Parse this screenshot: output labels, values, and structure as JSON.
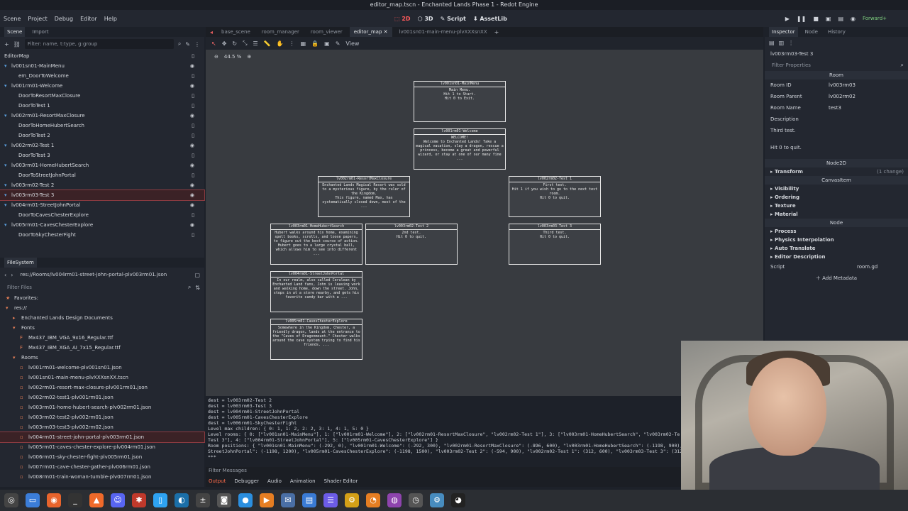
{
  "window": {
    "title": "editor_map.tscn - Enchanted Lands Phase 1 - Redot Engine"
  },
  "menu": [
    "Scene",
    "Project",
    "Debug",
    "Editor",
    "Help"
  ],
  "workspaces": [
    {
      "label": "2D",
      "active": true
    },
    {
      "label": "3D",
      "active": false
    },
    {
      "label": "Script",
      "active": false
    },
    {
      "label": "AssetLib",
      "active": false
    }
  ],
  "renderer": "Forward+",
  "scene_dock": {
    "tabs": [
      "Scene",
      "Import"
    ],
    "filter_placeholder": "Filter: name, t:type, g:group",
    "nodes": [
      {
        "label": "EditorMap",
        "indent": 0
      },
      {
        "label": "lv001sn01-MainMenu",
        "indent": 1
      },
      {
        "label": "em_DoorToWelcome",
        "indent": 2
      },
      {
        "label": "lv001rm01-Welcome",
        "indent": 1
      },
      {
        "label": "DoorToResortMaxClosure",
        "indent": 2
      },
      {
        "label": "DoorToTest 1",
        "indent": 2
      },
      {
        "label": "lv002rm01-ResortMaxClosure",
        "indent": 1
      },
      {
        "label": "DoorToHomeHubertSearch",
        "indent": 2
      },
      {
        "label": "DoorToTest 2",
        "indent": 2
      },
      {
        "label": "lv002rm02-Test 1",
        "indent": 1
      },
      {
        "label": "DoorToTest 3",
        "indent": 2
      },
      {
        "label": "lv003rm01-HomeHubertSearch",
        "indent": 1
      },
      {
        "label": "DoorToStreetJohnPortal",
        "indent": 2
      },
      {
        "label": "lv003rm02-Test 2",
        "indent": 1
      },
      {
        "label": "lv003rm03-Test 3",
        "indent": 1,
        "selected": true
      },
      {
        "label": "lv004rm01-StreetJohnPortal",
        "indent": 1
      },
      {
        "label": "DoorToCavesChesterExplore",
        "indent": 2
      },
      {
        "label": "lv005rm01-CavesChesterExplore",
        "indent": 1
      },
      {
        "label": "DoorToSkyChesterFight",
        "indent": 2
      }
    ]
  },
  "filesystem": {
    "title": "FileSystem",
    "path": "res://Rooms/lv004rm01-street-john-portal-plv003rm01.json",
    "filter_placeholder": "Filter Files",
    "entries": [
      {
        "label": "Favorites:",
        "indent": 0,
        "icon": "★"
      },
      {
        "label": "res://",
        "indent": 0,
        "icon": "▾"
      },
      {
        "label": "Enchanted Lands Design Documents",
        "indent": 1,
        "icon": "▸"
      },
      {
        "label": "Fonts",
        "indent": 1,
        "icon": "▾"
      },
      {
        "label": "Mx437_IBM_VGA_9x16_Regular.ttf",
        "indent": 2,
        "icon": "F"
      },
      {
        "label": "Mx437_IBM_XGA_AI_7x15_Regular.ttf",
        "indent": 2,
        "icon": "F"
      },
      {
        "label": "Rooms",
        "indent": 1,
        "icon": "▾"
      },
      {
        "label": "lv001rm01-welcome-plv001sn01.json",
        "indent": 2,
        "icon": "▫"
      },
      {
        "label": "lv001sn01-main-menu-plvXXXsnXX.tscn",
        "indent": 2,
        "icon": "▫"
      },
      {
        "label": "lv002rm01-resort-max-closure-plv001rm01.json",
        "indent": 2,
        "icon": "▫"
      },
      {
        "label": "lv002rm02-test1-plv001rm01.json",
        "indent": 2,
        "icon": "▫"
      },
      {
        "label": "lv003rm01-home-hubert-search-plv002rm01.json",
        "indent": 2,
        "icon": "▫"
      },
      {
        "label": "lv003rm02-test2-plv002rm01.json",
        "indent": 2,
        "icon": "▫"
      },
      {
        "label": "lv003rm03-test3-plv002rm02.json",
        "indent": 2,
        "icon": "▫"
      },
      {
        "label": "lv004rm01-street-john-portal-plv003rm01.json",
        "indent": 2,
        "icon": "▫",
        "selected": true
      },
      {
        "label": "lv005rm01-caves-chester-explore-plv004rm01.json",
        "indent": 2,
        "icon": "▫"
      },
      {
        "label": "lv006rm01-sky-chester-fight-plv005rm01.json",
        "indent": 2,
        "icon": "▫"
      },
      {
        "label": "lv007rm01-cave-chester-gather-plv006rm01.json",
        "indent": 2,
        "icon": "▫"
      },
      {
        "label": "lv008rm01-train-woman-tumble-plv007rm01.json",
        "indent": 2,
        "icon": "▫"
      }
    ]
  },
  "scene_tabs": [
    {
      "label": "base_scene",
      "active": false
    },
    {
      "label": "room_manager",
      "active": false
    },
    {
      "label": "room_viewer",
      "active": false
    },
    {
      "label": "editor_map",
      "active": true
    },
    {
      "label": "lv001sn01-main-menu-plvXXXsnXX",
      "active": false
    }
  ],
  "viewport": {
    "toolbar_view": "View",
    "zoom": "44.5 %",
    "rooms": [
      {
        "title": "lv001sn01-MainMenu",
        "body": "Main Menu.\nHit 1 to Start.\nHit 0 to Exit."
      },
      {
        "title": "lv001rm01-Welcome",
        "body": "WELCOME!\nWelcome to Enchanted Lands! Take a magical vacation, slay a dragon, rescue a princess, become a great and powerful wizard, or stay at one of our many fine ..."
      },
      {
        "title": "lv002rm01-ResortMaxClosure",
        "body": "Enchanted Lands Magical Resort was sold to a mysterious figure, by the ruler of the Kingdom.\nThis figure, named Max, has systematically closed down, most of the ..."
      },
      {
        "title": "lv002rm02-Test 1",
        "body": "First test.\nHit 1 if you wish to go to the next test room.\nHit 0 to quit."
      },
      {
        "title": "lv003rm01-HomeHubertSearch",
        "body": "Hubert walks around his home, examining spell books, scrolls, and loose papers, to figure out the best course of action. Hubert goes to a large crystal ball, which allows him to see into different ..."
      },
      {
        "title": "lv003rm02-Test 2",
        "body": "2nd test.\nHit 0 to quit."
      },
      {
        "title": "lv003rm03-Test 3",
        "body": "Third test.\nHit 0 to quit."
      },
      {
        "title": "lv004rm01-StreetJohnPortal",
        "body": "In our realm, also called Cerulean by Enchanted Land fans, John is leaving work and walking home, down the street. John, stops in at a store nearby, and gets his favorite candy bar with a ..."
      },
      {
        "title": "lv005rm01-CavesChesterExplore",
        "body": "Somewhere in the Kingdom, Chester, a friendly dragon, lands at the entrance to the \"Caves of Dragonmount.\" Chester walks around the cave system trying to find his friends. ..."
      }
    ]
  },
  "output_lines": [
    "dest = lv003rm02-Test 2",
    "dest = lv003rm03-Test 3",
    "dest = lv004rm01-StreetJohnPortal",
    "dest = lv005rm01-CavesChesterExplore",
    "dest = lv006rm01-SkyChesterFight",
    "Level max children: { 0: 1, 1: 2, 2: 2, 3: 1, 4: 1, 5: 0 }",
    "Level rooms: { 0: [\"lv001sn01-MainMenu\"], 1: [\"lv001rm01-Welcome\"], 2: [\"lv002rm01-ResortMaxClosure\", \"lv002rm02-Test 1\"], 3: [\"lv003rm01-HomeHubertSearch\", \"lv003rm02-Te",
    "Test 3\"], 4: [\"lv004rm01-StreetJohnPortal\"], 5: [\"lv005rm01-CavesChesterExplore\"] }",
    "Room positions: { \"lv001sn01-MainMenu\": (-292, 0), \"lv001rm01-Welcome\": (-292, 300), \"lv002rm01-ResortMaxClosure\": (-896, 600), \"lv003rm01-HomeHubertSearch\": (-1198, 900), \"lv004rm0",
    "StreetJohnPortal\": (-1198, 1200), \"lv005rm01-CavesChesterExplore\": (-1198, 1500), \"lv003rm02-Test 2\": (-594, 900), \"lv002rm02-Test 1\": (312, 600), \"lv003rm03-Test 3\": (312",
    "***"
  ],
  "filter_messages": "Filter Messages",
  "bottom_tabs": [
    {
      "label": "Output",
      "active": true
    },
    {
      "label": "Debugger",
      "active": false
    },
    {
      "label": "Audio",
      "active": false
    },
    {
      "label": "Animation",
      "active": false
    },
    {
      "label": "Shader Editor",
      "active": false
    }
  ],
  "inspector": {
    "tabs": [
      "Inspector",
      "Node",
      "History"
    ],
    "object": "lv003rm03-Test 3",
    "filter_placeholder": "Filter Properties",
    "section_room": "Room",
    "props": [
      {
        "name": "Room ID",
        "value": "lv003rm03"
      },
      {
        "name": "Room Parent",
        "value": "lv002rm02"
      },
      {
        "name": "Room Name",
        "value": "test3"
      },
      {
        "name": "Description",
        "value": ""
      }
    ],
    "description_text1": "Third test.",
    "description_text2": "Hit 0 to quit.",
    "section_node2d": "Node2D",
    "transform": "Transform",
    "transform_changes": "(1 change)",
    "section_canvasitem": "CanvasItem",
    "canvas_groups": [
      "Visibility",
      "Ordering",
      "Texture",
      "Material"
    ],
    "section_node": "Node",
    "node_groups": [
      "Process",
      "Physics Interpolation",
      "Auto Translate",
      "Editor Description"
    ],
    "script_label": "Script",
    "script_value": "room.gd",
    "add_metadata": "Add Metadata"
  },
  "colors": {
    "accent": "#ff5a5a",
    "selection": "#3b2226"
  }
}
